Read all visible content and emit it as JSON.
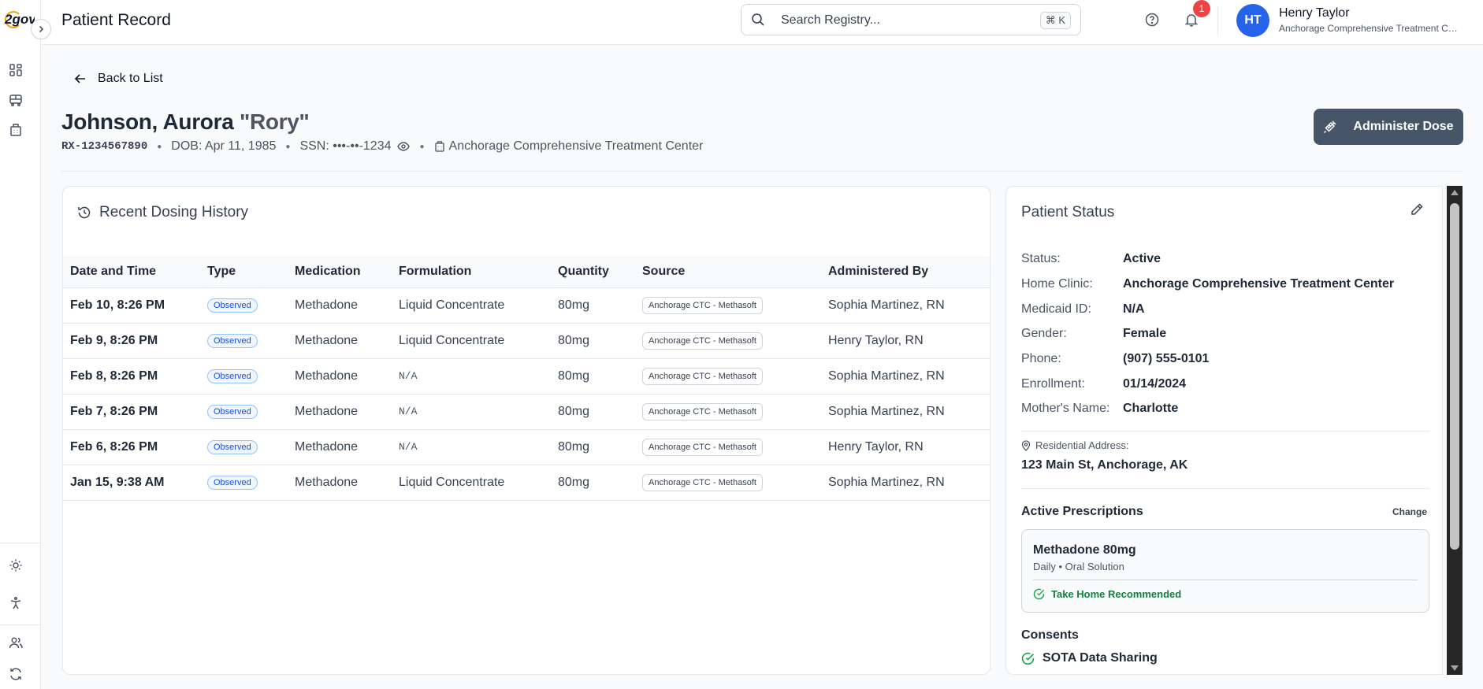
{
  "app": {
    "logo_text": "2gov",
    "page_title": "Patient Record"
  },
  "search": {
    "placeholder": "Search Registry...",
    "shortcut": "⌘ K"
  },
  "notifications": {
    "count": "1"
  },
  "user": {
    "initials": "HT",
    "name": "Henry Taylor",
    "clinic": "Anchorage Comprehensive Treatment Center"
  },
  "sidebar": {
    "top_icons": [
      "dashboard-icon",
      "bus-icon",
      "building-icon"
    ],
    "bottom_icons": [
      "sun-icon",
      "accessibility-icon",
      "users-icon",
      "refresh-icon"
    ]
  },
  "nav": {
    "back_label": "Back to List"
  },
  "patient": {
    "last_first": "Johnson, Aurora ",
    "nickname": "\"Rory\"",
    "rx_id": "RX-1234567890",
    "dob": "DOB: Apr 11, 1985",
    "ssn": "SSN: •••-••-1234",
    "clinic": "Anchorage Comprehensive Treatment Center"
  },
  "actions": {
    "administer_label": "Administer Dose"
  },
  "dosing": {
    "title": "Recent Dosing History",
    "columns": [
      "Date and Time",
      "Type",
      "Medication",
      "Formulation",
      "Quantity",
      "Source",
      "Administered By"
    ],
    "rows": [
      {
        "date": "Feb 10, 8:26 PM",
        "type": "Observed",
        "medication": "Methadone",
        "formulation": "Liquid Concentrate",
        "quantity": "80mg",
        "source": "Anchorage CTC - Methasoft",
        "by": "Sophia Martinez, RN"
      },
      {
        "date": "Feb 9, 8:26 PM",
        "type": "Observed",
        "medication": "Methadone",
        "formulation": "Liquid Concentrate",
        "quantity": "80mg",
        "source": "Anchorage CTC - Methasoft",
        "by": "Henry Taylor, RN"
      },
      {
        "date": "Feb 8, 8:26 PM",
        "type": "Observed",
        "medication": "Methadone",
        "formulation": "N/A",
        "quantity": "80mg",
        "source": "Anchorage CTC - Methasoft",
        "by": "Sophia Martinez, RN"
      },
      {
        "date": "Feb 7, 8:26 PM",
        "type": "Observed",
        "medication": "Methadone",
        "formulation": "N/A",
        "quantity": "80mg",
        "source": "Anchorage CTC - Methasoft",
        "by": "Sophia Martinez, RN"
      },
      {
        "date": "Feb 6, 8:26 PM",
        "type": "Observed",
        "medication": "Methadone",
        "formulation": "N/A",
        "quantity": "80mg",
        "source": "Anchorage CTC - Methasoft",
        "by": "Henry Taylor, RN"
      },
      {
        "date": "Jan 15, 9:38 AM",
        "type": "Observed",
        "medication": "Methadone",
        "formulation": "Liquid Concentrate",
        "quantity": "80mg",
        "source": "Anchorage CTC - Methasoft",
        "by": "Sophia Martinez, RN"
      }
    ]
  },
  "status": {
    "title": "Patient Status",
    "fields": [
      {
        "label": "Status:",
        "value": "Active"
      },
      {
        "label": "Home Clinic:",
        "value": "Anchorage Comprehensive Treatment Center"
      },
      {
        "label": "Medicaid ID:",
        "value": "N/A"
      },
      {
        "label": "Gender:",
        "value": "Female"
      },
      {
        "label": "Phone:",
        "value": "(907) 555-0101"
      },
      {
        "label": "Enrollment:",
        "value": "01/14/2024"
      },
      {
        "label": "Mother's Name:",
        "value": "Charlotte"
      }
    ],
    "address_label": "Residential Address:",
    "address_value": "123 Main St, Anchorage, AK",
    "prescriptions_title": "Active Prescriptions",
    "change_label": "Change",
    "prescription": {
      "name": "Methadone 80mg",
      "detail": "Daily • Oral Solution",
      "recommendation": "Take Home Recommended"
    },
    "consents_title": "Consents",
    "consents": [
      "SOTA Data Sharing"
    ]
  },
  "colors": {
    "primary_button": "#475569",
    "avatar": "#2563eb",
    "badge_red": "#ef4444",
    "success_green": "#15803d",
    "observed_blue": "#1d4ed8"
  }
}
